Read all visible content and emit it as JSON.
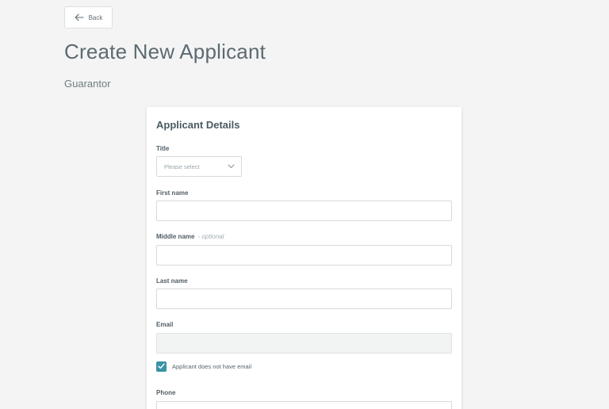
{
  "header": {
    "back_label": "Back",
    "title": "Create New Applicant",
    "subtitle": "Guarantor"
  },
  "form": {
    "title": "Applicant Details",
    "title_field": {
      "label": "Title",
      "placeholder": "Please select"
    },
    "first_name": {
      "label": "First name",
      "value": ""
    },
    "middle_name": {
      "label": "Middle name",
      "optional_note": "- optional",
      "value": ""
    },
    "last_name": {
      "label": "Last name",
      "value": ""
    },
    "email": {
      "label": "Email",
      "value": "",
      "disabled": true
    },
    "no_email_checkbox": {
      "label": "Applicant does not have email",
      "checked": true
    },
    "phone": {
      "label": "Phone",
      "value": ""
    }
  },
  "colors": {
    "background": "#f4f4f4",
    "card": "#ffffff",
    "accent": "#3a93a6",
    "text": "#4a5a62"
  },
  "icons": {
    "back": "arrow-left-icon",
    "select": "chevron-down-icon",
    "checkbox": "check-icon"
  }
}
